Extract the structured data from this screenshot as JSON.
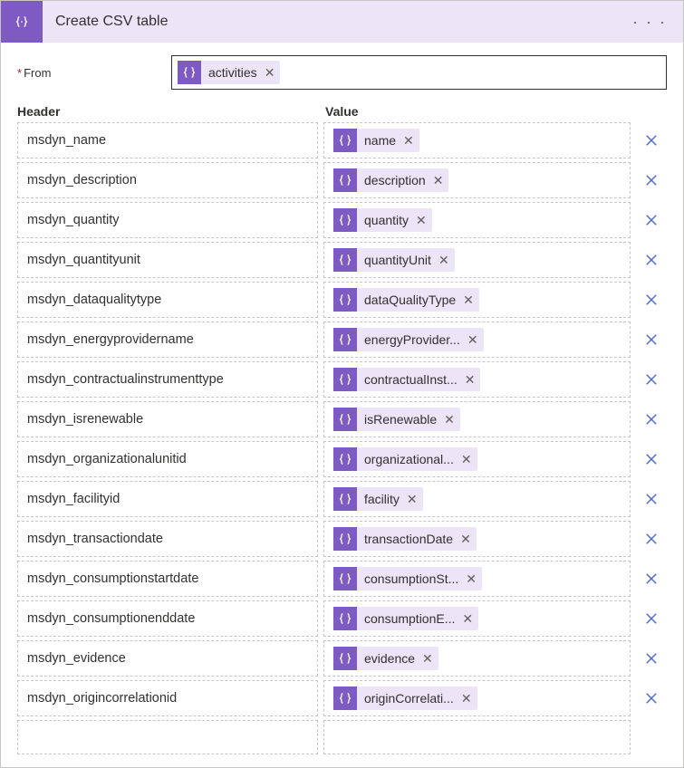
{
  "header": {
    "title": "Create CSV table",
    "menu_label": "· · ·"
  },
  "from": {
    "label": "From",
    "token": "activities"
  },
  "columns": {
    "header_col": "Header",
    "value_col": "Value"
  },
  "rows": [
    {
      "header": "msdyn_name",
      "value_token": "name"
    },
    {
      "header": "msdyn_description",
      "value_token": "description"
    },
    {
      "header": "msdyn_quantity",
      "value_token": "quantity"
    },
    {
      "header": "msdyn_quantityunit",
      "value_token": "quantityUnit"
    },
    {
      "header": "msdyn_dataqualitytype",
      "value_token": "dataQualityType"
    },
    {
      "header": "msdyn_energyprovidername",
      "value_token": "energyProvider..."
    },
    {
      "header": "msdyn_contractualinstrumenttype",
      "value_token": "contractualInst..."
    },
    {
      "header": "msdyn_isrenewable",
      "value_token": "isRenewable"
    },
    {
      "header": "msdyn_organizationalunitid",
      "value_token": "organizational..."
    },
    {
      "header": "msdyn_facilityid",
      "value_token": "facility"
    },
    {
      "header": "msdyn_transactiondate",
      "value_token": "transactionDate"
    },
    {
      "header": "msdyn_consumptionstartdate",
      "value_token": "consumptionSt..."
    },
    {
      "header": "msdyn_consumptionenddate",
      "value_token": "consumptionE..."
    },
    {
      "header": "msdyn_evidence",
      "value_token": "evidence"
    },
    {
      "header": "msdyn_origincorrelationid",
      "value_token": "originCorrelati..."
    }
  ]
}
